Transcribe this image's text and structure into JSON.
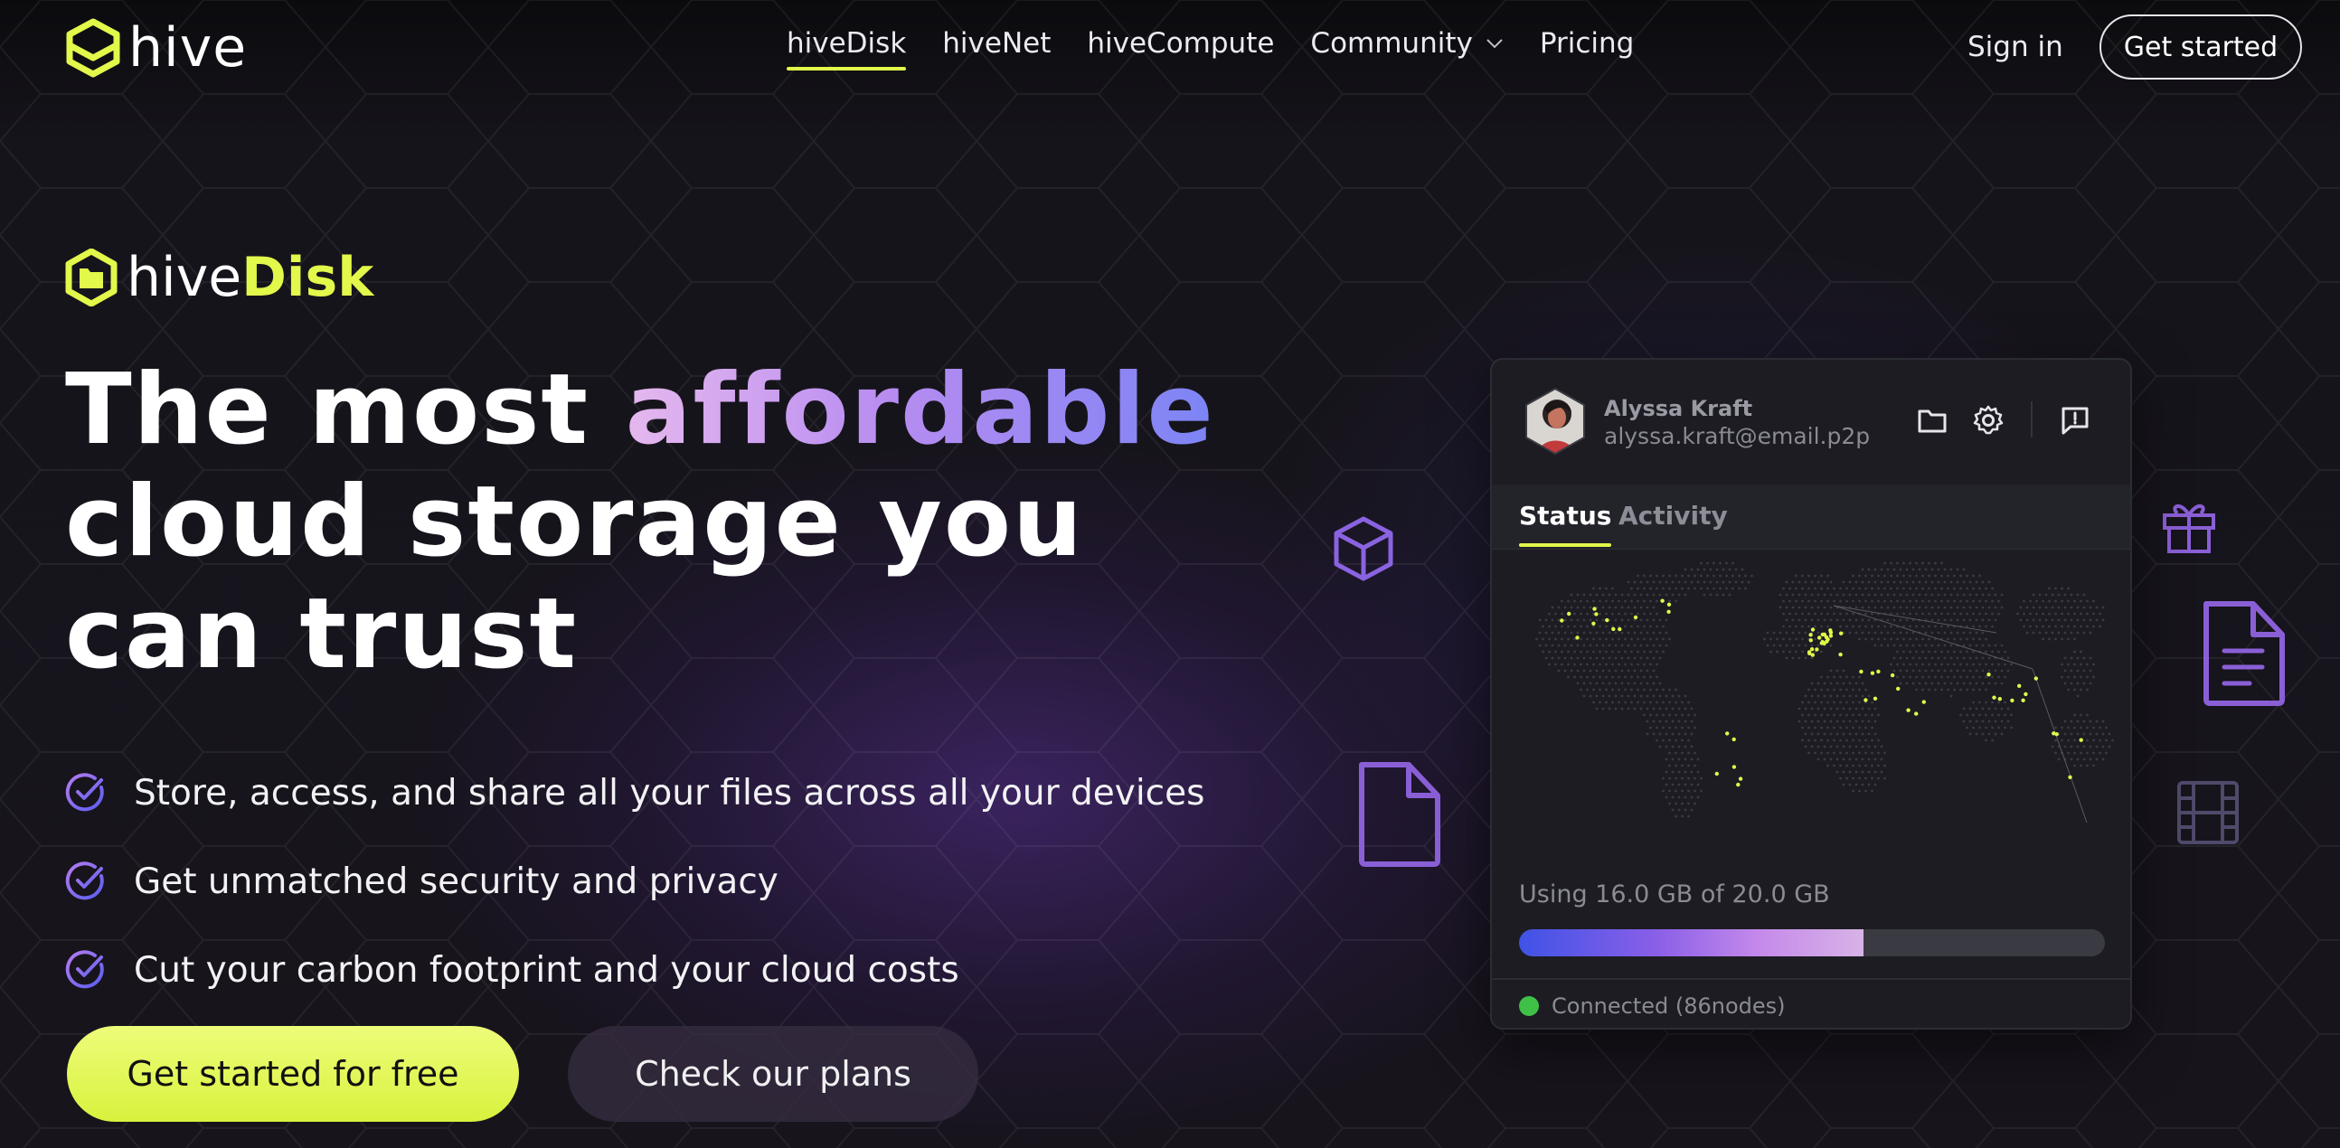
{
  "nav": {
    "brand": "hive",
    "links": [
      {
        "label": "hiveDisk",
        "active": true
      },
      {
        "label": "hiveNet",
        "active": false
      },
      {
        "label": "hiveCompute",
        "active": false
      },
      {
        "label": "Community",
        "active": false,
        "has_dropdown": true
      },
      {
        "label": "Pricing",
        "active": false
      }
    ],
    "sign_in": "Sign in",
    "cta": "Get started"
  },
  "hero": {
    "product_prefix": "hive",
    "product_suffix": "Disk",
    "headline_before": "The most ",
    "headline_highlight": "affordable",
    "headline_line2": "cloud storage you",
    "headline_line3": "can trust",
    "bullets": [
      "Store, access, and share all your files across all your devices",
      "Get unmatched security and privacy",
      "Cut your carbon footprint and your cloud costs"
    ],
    "primary_button": "Get started for free",
    "secondary_button": "Check our plans"
  },
  "app_card": {
    "user_name": "Alyssa Kraft",
    "user_email": "alyssa.kraft@email.p2p",
    "header_icons": [
      "folder-icon",
      "gear-icon",
      "feedback-icon"
    ],
    "tabs": [
      {
        "label": "Status",
        "active": true
      },
      {
        "label": "Activity",
        "active": false
      }
    ],
    "usage_text": "Using 16.0 GB of 20.0 GB",
    "usage_used_gb": 16.0,
    "usage_total_gb": 20.0,
    "connection_text": "Connected (86nodes)"
  },
  "floating_icons": [
    "cube-icon",
    "file-icon",
    "gift-icon",
    "document-icon",
    "film-icon"
  ],
  "colors": {
    "accent": "#e2f84a",
    "purple": "#8a5fd6",
    "connected": "#3ec146"
  }
}
